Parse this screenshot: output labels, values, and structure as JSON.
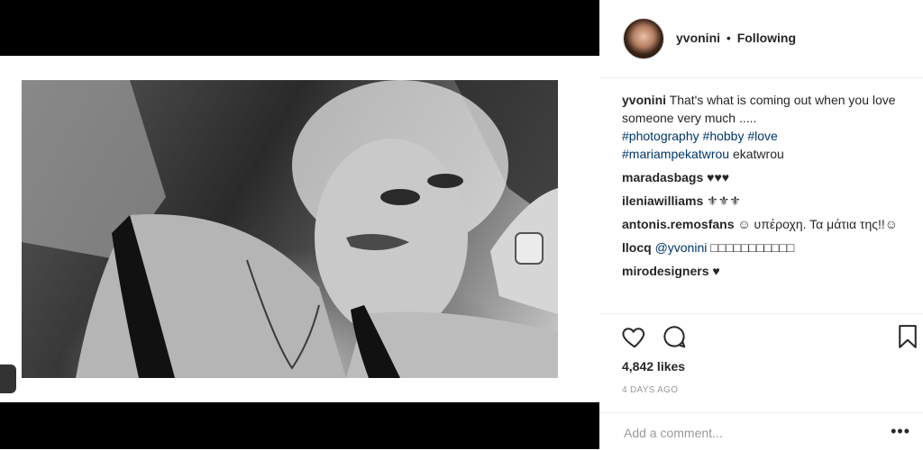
{
  "post": {
    "username": "yvonini",
    "separator": "•",
    "follow_status": "Following",
    "caption": {
      "user": "yvonini",
      "text": "That's what is coming out when you love someone very much .....",
      "tags": [
        "#photography",
        "#hobby",
        "#love",
        "#mariampekatwrou"
      ],
      "trailing": "ekatwrou"
    },
    "comments": [
      {
        "user": "maradasbags",
        "text": "♥♥♥"
      },
      {
        "user": "ileniawilliams",
        "text": "⚜⚜⚜"
      },
      {
        "user": "antonis.remosfans",
        "text": "☺ υπέροχη. Τα μάτια της!!☺"
      },
      {
        "user": "llocq",
        "mention": "@yvonini",
        "text": "□□□□□□□□□□□"
      },
      {
        "user": "mirodesigners",
        "text": "♥"
      }
    ],
    "likes": "4,842 likes",
    "time_ago": "4 DAYS AGO",
    "add_comment_placeholder": "Add a comment...",
    "more_label": "•••"
  },
  "icons": {
    "like": "heart-icon",
    "comment": "comment-icon",
    "save": "bookmark-icon",
    "avatar": "avatar"
  },
  "colors": {
    "link": "#003569",
    "text": "#262626",
    "muted": "#999999",
    "border": "#efefef"
  }
}
